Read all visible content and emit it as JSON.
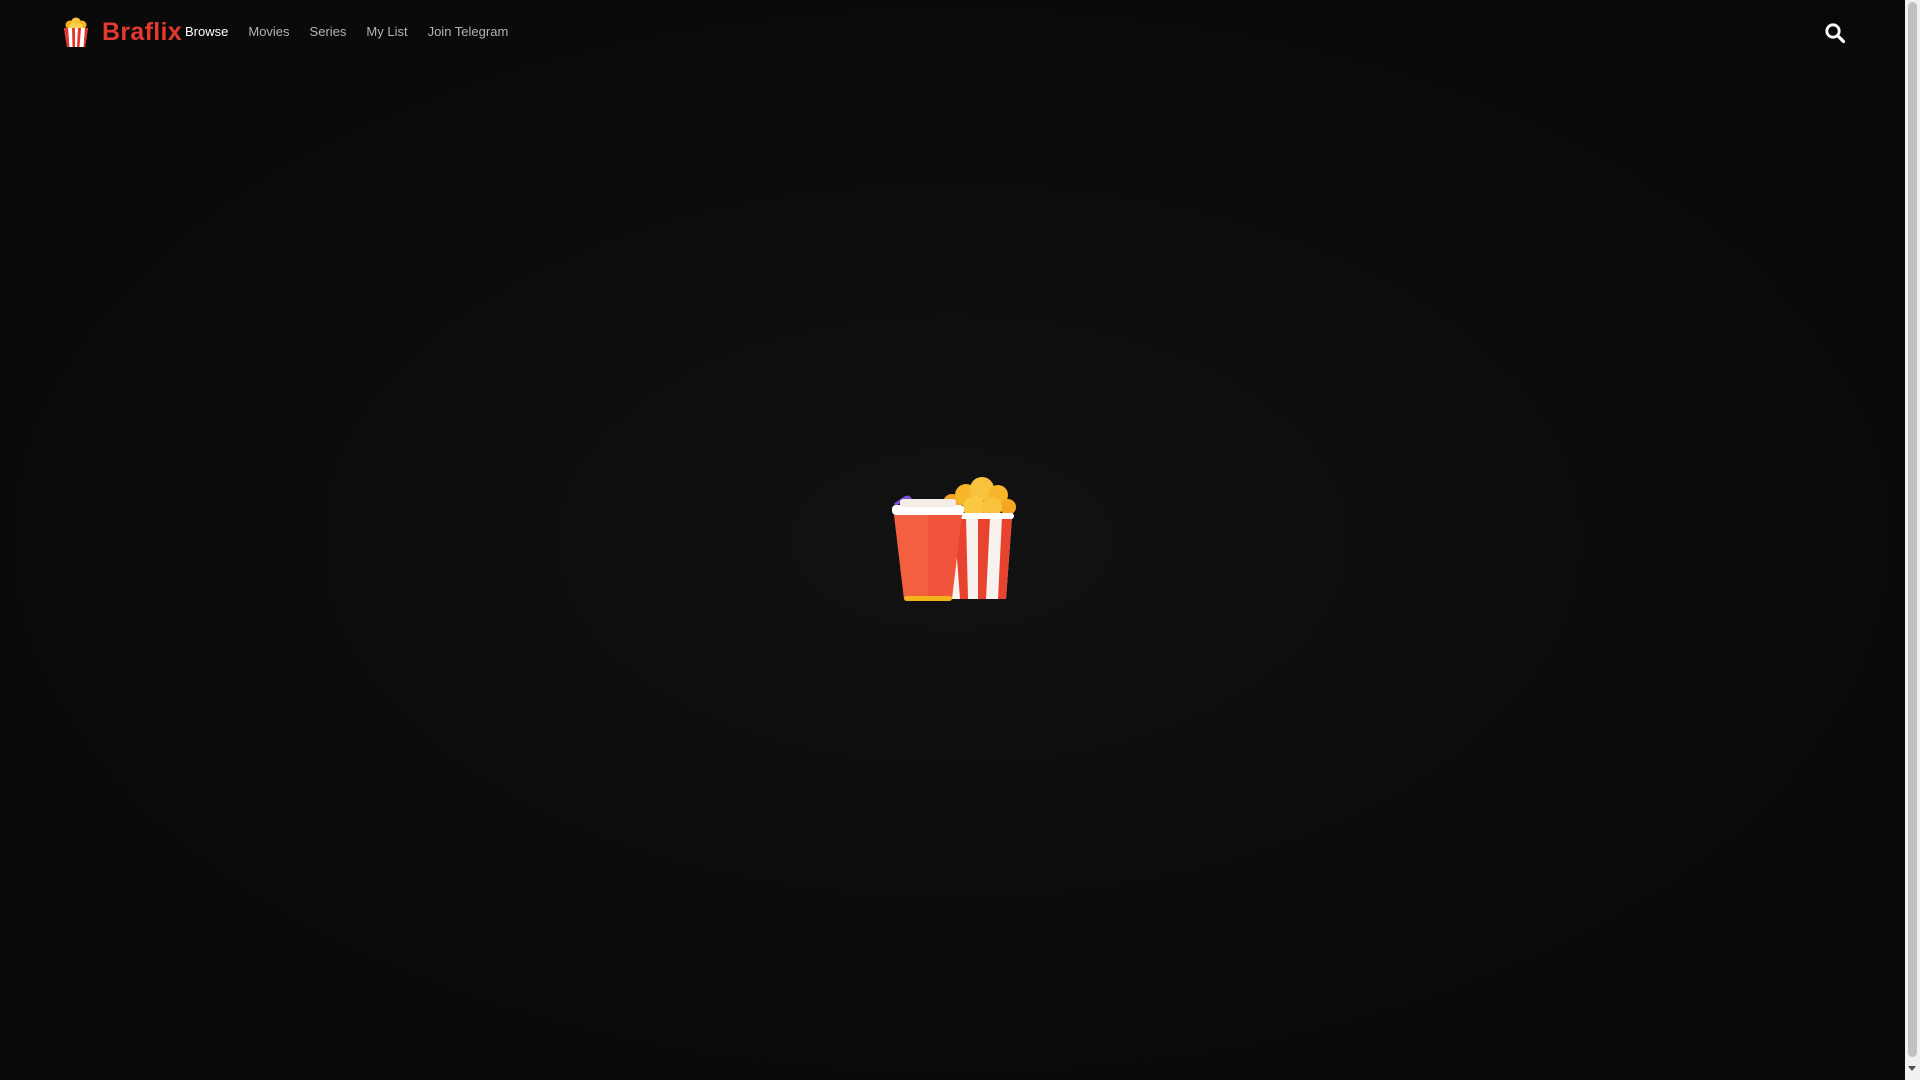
{
  "brand": {
    "name": "Braflix",
    "color": "#e23a2f"
  },
  "nav": {
    "items": [
      {
        "label": "Browse",
        "active": true
      },
      {
        "label": "Movies",
        "active": false
      },
      {
        "label": "Series",
        "active": false
      },
      {
        "label": "My List",
        "active": false
      },
      {
        "label": "Join Telegram",
        "active": false
      }
    ]
  },
  "icons": {
    "logo": "popcorn-bucket-icon",
    "search": "search-icon",
    "loader": "popcorn-and-soda-icon"
  },
  "colors": {
    "background": "#0c0c0c",
    "nav_active": "#ffffff",
    "nav_inactive": "#b3b3b3"
  }
}
